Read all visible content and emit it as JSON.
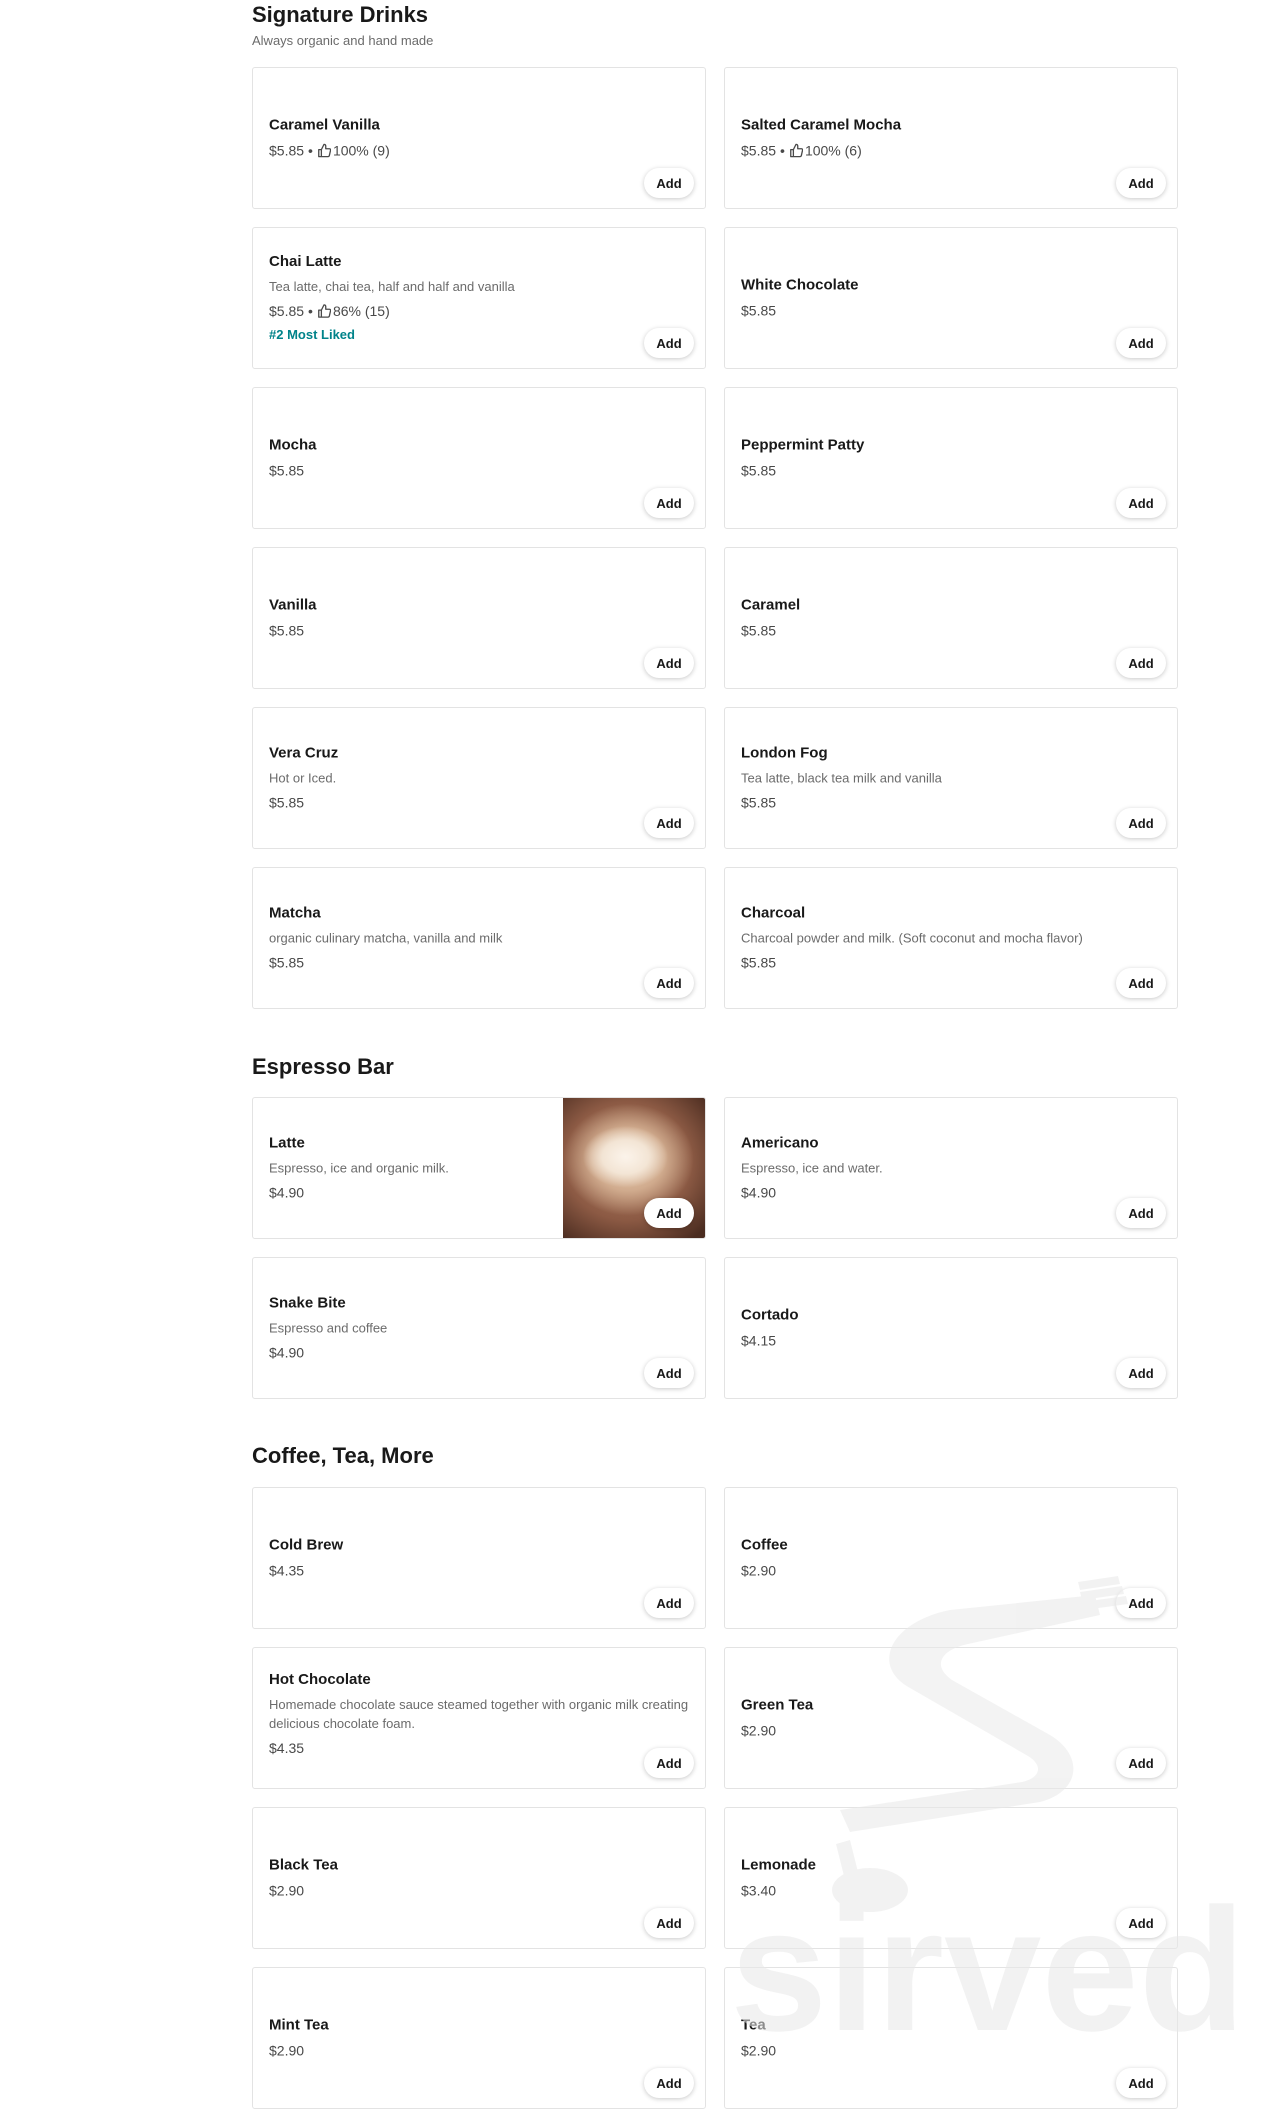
{
  "add_label": "Add",
  "sections": [
    {
      "title": "Signature Drinks",
      "subtitle": "Always organic and hand made",
      "items": [
        {
          "name": "Caramel Vanilla",
          "description": "",
          "price": "$5.85",
          "rating": "100% (9)",
          "tag": ""
        },
        {
          "name": "Salted Caramel Mocha",
          "description": "",
          "price": "$5.85",
          "rating": "100% (6)",
          "tag": ""
        },
        {
          "name": "Chai Latte",
          "description": "Tea latte, chai tea, half and half and vanilla",
          "price": "$5.85",
          "rating": "86% (15)",
          "tag": "#2 Most Liked"
        },
        {
          "name": "White Chocolate",
          "description": "",
          "price": "$5.85",
          "rating": "",
          "tag": ""
        },
        {
          "name": "Mocha",
          "description": "",
          "price": "$5.85",
          "rating": "",
          "tag": ""
        },
        {
          "name": "Peppermint Patty",
          "description": "",
          "price": "$5.85",
          "rating": "",
          "tag": ""
        },
        {
          "name": "Vanilla",
          "description": "",
          "price": "$5.85",
          "rating": "",
          "tag": ""
        },
        {
          "name": "Caramel",
          "description": "",
          "price": "$5.85",
          "rating": "",
          "tag": ""
        },
        {
          "name": "Vera Cruz",
          "description": "Hot or Iced.",
          "price": "$5.85",
          "rating": "",
          "tag": ""
        },
        {
          "name": "London Fog",
          "description": "Tea latte, black tea milk and vanilla",
          "price": "$5.85",
          "rating": "",
          "tag": ""
        },
        {
          "name": "Matcha",
          "description": "organic culinary matcha, vanilla and milk",
          "price": "$5.85",
          "rating": "",
          "tag": ""
        },
        {
          "name": "Charcoal",
          "description": "Charcoal powder and milk. (Soft coconut and mocha flavor)",
          "price": "$5.85",
          "rating": "",
          "tag": ""
        }
      ]
    },
    {
      "title": "Espresso Bar",
      "subtitle": "",
      "items": [
        {
          "name": "Latte",
          "description": "Espresso, ice and organic milk.",
          "price": "$4.90",
          "rating": "",
          "tag": "",
          "image": "latte-art-photo"
        },
        {
          "name": "Americano",
          "description": "Espresso, ice and water.",
          "price": "$4.90",
          "rating": "",
          "tag": ""
        },
        {
          "name": "Snake Bite",
          "description": "Espresso and coffee",
          "price": "$4.90",
          "rating": "",
          "tag": ""
        },
        {
          "name": "Cortado",
          "description": "",
          "price": "$4.15",
          "rating": "",
          "tag": ""
        }
      ]
    },
    {
      "title": "Coffee, Tea, More",
      "subtitle": "",
      "items": [
        {
          "name": "Cold Brew",
          "description": "",
          "price": "$4.35",
          "rating": "",
          "tag": ""
        },
        {
          "name": "Coffee",
          "description": "",
          "price": "$2.90",
          "rating": "",
          "tag": ""
        },
        {
          "name": "Hot Chocolate",
          "description": "Homemade chocolate sauce steamed together with organic milk creating delicious chocolate foam.",
          "price": "$4.35",
          "rating": "",
          "tag": ""
        },
        {
          "name": "Green Tea",
          "description": "",
          "price": "$2.90",
          "rating": "",
          "tag": ""
        },
        {
          "name": "Black Tea",
          "description": "",
          "price": "$2.90",
          "rating": "",
          "tag": ""
        },
        {
          "name": "Lemonade",
          "description": "",
          "price": "$3.40",
          "rating": "",
          "tag": ""
        },
        {
          "name": "Mint Tea",
          "description": "",
          "price": "$2.90",
          "rating": "",
          "tag": ""
        },
        {
          "name": "Tea",
          "description": "",
          "price": "$2.90",
          "rating": "",
          "tag": ""
        }
      ]
    }
  ],
  "watermark": {
    "text": "sirved",
    "icon": "fork-and-spoon-logo"
  },
  "colors": {
    "accent_tag": "#00838a",
    "card_border": "#e3e3e3",
    "text_primary": "#191919",
    "text_secondary": "#6b6b6b"
  }
}
